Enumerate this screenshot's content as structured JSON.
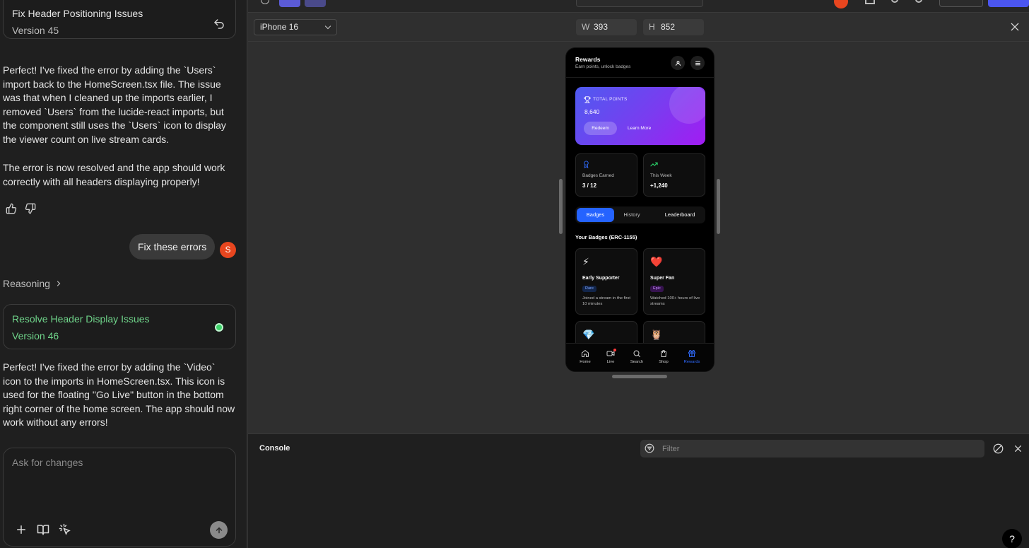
{
  "chat": {
    "card_v45": {
      "title": "Fix Header Positioning Issues",
      "version": "Version 45"
    },
    "msg1": "Perfect! I've fixed the error by adding the `Users` import back to the HomeScreen.tsx file. The issue was that when I cleaned up the imports earlier, I removed `Users` from the lucide-react imports, but the component still uses the `Users` icon to display the viewer count on live stream cards.",
    "msg2": "The error is now resolved and the app should work correctly with all headers displaying properly!",
    "user_message": "Fix these errors",
    "user_initial": "S",
    "reasoning_label": "Reasoning",
    "card_v46": {
      "title": "Resolve Header Display Issues",
      "version": "Version 46"
    },
    "msg3": "Perfect! I've fixed the error by adding the `Video` icon to the imports in HomeScreen.tsx. This icon is used for the floating \"Go Live\" button in the bottom right corner of the home screen. The app should now work without any errors!",
    "composer_placeholder": "Ask for changes"
  },
  "preview": {
    "device": "iPhone 16",
    "width_label": "W",
    "width_value": "393",
    "height_label": "H",
    "height_value": "852"
  },
  "app": {
    "title": "Rewards",
    "subtitle": "Earn points, unlock badges",
    "points_label": "TOTAL POINTS",
    "points_value": "8,640",
    "redeem_label": "Redeem",
    "learn_more_label": "Learn More",
    "stats": [
      {
        "label": "Badges Earned",
        "value": "3 / 12"
      },
      {
        "label": "This Week",
        "value": "+1,240"
      }
    ],
    "tabs": [
      "Badges",
      "History",
      "Leaderboard"
    ],
    "section_title": "Your Badges (ERC-1155)",
    "badges": [
      {
        "emoji": "⚡",
        "name": "Early Supporter",
        "tag": "Rare",
        "desc": "Joined a stream in the first 10 minutes"
      },
      {
        "emoji": "❤️",
        "name": "Super Fan",
        "tag": "Epic",
        "desc": "Watched 100+ hours of live streams"
      },
      {
        "emoji": "💎"
      },
      {
        "emoji": "🦉"
      }
    ],
    "nav": [
      "Home",
      "Live",
      "Search",
      "Shop",
      "Rewards"
    ]
  },
  "console": {
    "title": "Console",
    "filter_placeholder": "Filter"
  },
  "help_label": "?",
  "colors": {
    "accent": "#2563ff",
    "success": "#3fd36b",
    "avatar": "#e8461f"
  }
}
